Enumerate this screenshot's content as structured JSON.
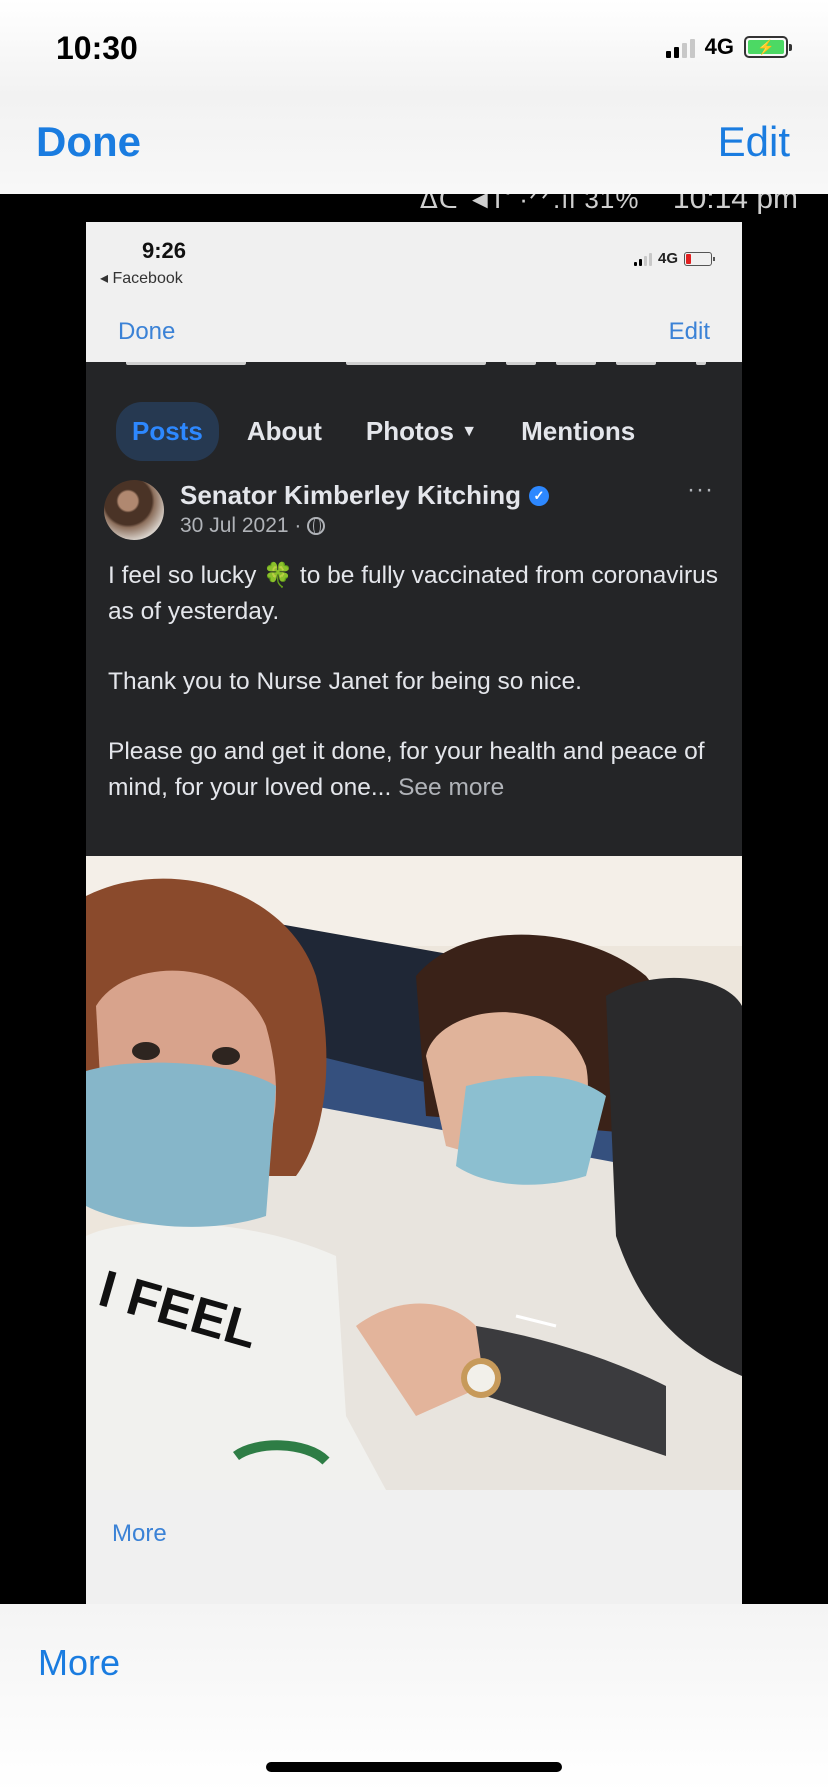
{
  "outer_status": {
    "time": "10:30",
    "network": "4G",
    "battery_icon": "battery-charging-icon"
  },
  "outer_nav": {
    "done_label": "Done",
    "edit_label": "Edit"
  },
  "cut_status": {
    "text": "ᐃᑕ ◄ᒋ ·ᐟᐟ.ıl 31%",
    "time": "10:14 pm"
  },
  "inner": {
    "status": {
      "time": "9:26",
      "back_label": "◂ Facebook",
      "network": "4G"
    },
    "nav": {
      "done_label": "Done",
      "edit_label": "Edit"
    },
    "tabs": [
      {
        "label": "Posts",
        "active": true
      },
      {
        "label": "About"
      },
      {
        "label": "Photos"
      },
      {
        "label": "Mentions"
      }
    ],
    "post": {
      "author": "Senator Kimberley Kitching",
      "date": "30 Jul 2021 ·",
      "more_dots": "···",
      "line1_a": "I feel so lucky ",
      "clover": "🍀",
      "line1_b": " to be fully vaccinated from coronavirus as of yesterday.",
      "paragraph2": "Thank you to Nurse Janet for being so nice.",
      "paragraph3": "Please go and get it done, for your health and peace of mind, for your loved one...",
      "see_more": "See more"
    },
    "photo": {
      "shirt_text": "I FEEL"
    },
    "more_label": "More"
  },
  "outer_bottom": {
    "more_label": "More"
  }
}
